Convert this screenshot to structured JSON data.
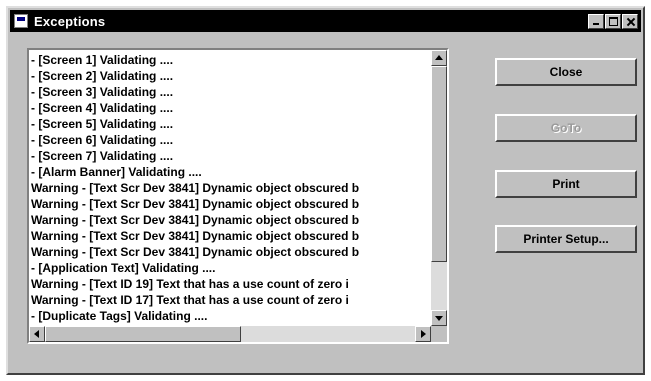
{
  "window": {
    "title": "Exceptions"
  },
  "list": {
    "lines": [
      "- [Screen 1] Validating ....",
      "- [Screen 2] Validating ....",
      "- [Screen 3] Validating ....",
      "- [Screen 4] Validating ....",
      "- [Screen 5] Validating ....",
      "- [Screen 6] Validating ....",
      "- [Screen 7] Validating ....",
      "- [Alarm Banner] Validating ....",
      "Warning - [Text Scr Dev 3841] Dynamic object obscured b",
      "Warning - [Text Scr Dev 3841] Dynamic object obscured b",
      "Warning - [Text Scr Dev 3841] Dynamic object obscured b",
      "Warning - [Text Scr Dev 3841] Dynamic object obscured b",
      "Warning - [Text Scr Dev 3841] Dynamic object obscured b",
      "- [Application Text] Validating ....",
      "Warning - [Text ID 19] Text that has a use count of zero i",
      "Warning - [Text ID 17] Text that has a use count of zero i",
      "- [Duplicate Tags] Validating ...."
    ]
  },
  "buttons": {
    "close": "Close",
    "goto": "GoTo",
    "print": "Print",
    "printer_setup": "Printer Setup..."
  },
  "colors": {
    "face": "#c0c0c0",
    "titlebar": "#000000",
    "disabled_text": "#9a9a9a"
  }
}
